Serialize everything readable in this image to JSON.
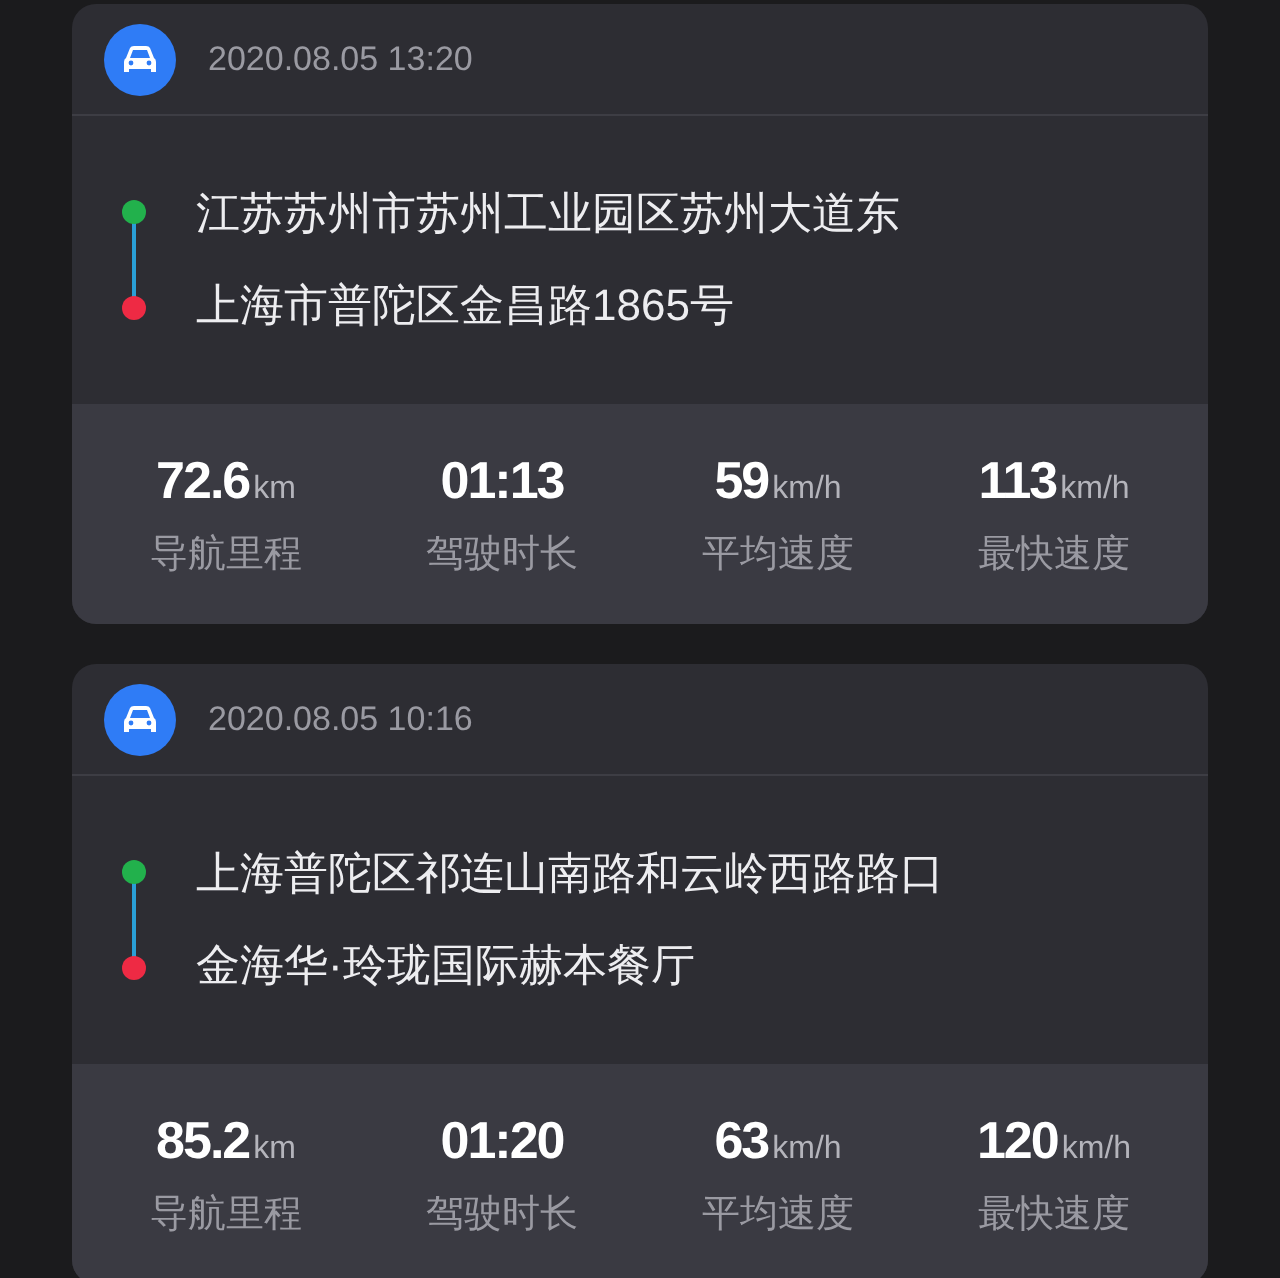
{
  "trips": [
    {
      "time": "2020.08.05 13:20",
      "start": "江苏苏州市苏州工业园区苏州大道东",
      "end": "上海市普陀区金昌路1865号",
      "stats": [
        {
          "value": "72.6",
          "unit": "km",
          "label": "导航里程"
        },
        {
          "value": "01:13",
          "label": "驾驶时长"
        },
        {
          "value": "59",
          "unit": "km/h",
          "label": "平均速度"
        },
        {
          "value": "113",
          "unit": "km/h",
          "label": "最快速度"
        }
      ]
    },
    {
      "time": "2020.08.05 10:16",
      "start": "上海普陀区祁连山南路和云岭西路路口",
      "end": "金海华·玲珑国际赫本餐厅",
      "stats": [
        {
          "value": "85.2",
          "unit": "km",
          "label": "导航里程"
        },
        {
          "value": "01:20",
          "label": "驾驶时长"
        },
        {
          "value": "63",
          "unit": "km/h",
          "label": "平均速度"
        },
        {
          "value": "120",
          "unit": "km/h",
          "label": "最快速度"
        }
      ]
    }
  ]
}
